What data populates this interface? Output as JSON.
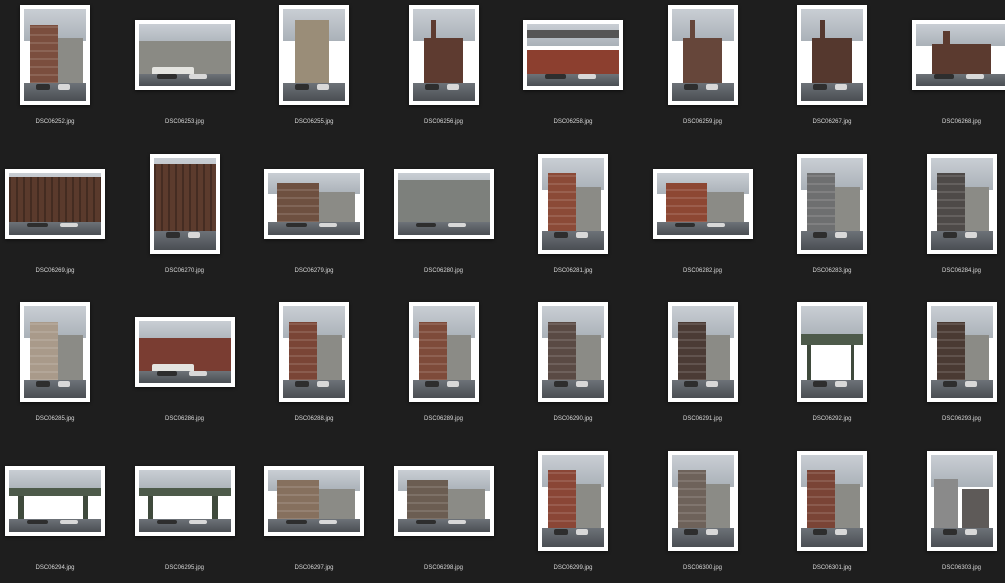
{
  "files": [
    {
      "name": "DSC06252.jpg",
      "orientation": "portrait",
      "scene": "building",
      "color": "#7b4e3e"
    },
    {
      "name": "DSC06253.jpg",
      "orientation": "landscape",
      "scene": "car",
      "color": "#8a8a84"
    },
    {
      "name": "DSC06255.jpg",
      "orientation": "portrait",
      "scene": "tower",
      "color": "#9a8d78"
    },
    {
      "name": "DSC06256.jpg",
      "orientation": "portrait",
      "scene": "factory",
      "color": "#5e3b30"
    },
    {
      "name": "DSC06258.jpg",
      "orientation": "landscape",
      "scene": "bridge",
      "color": "#8c3f2f"
    },
    {
      "name": "DSC06259.jpg",
      "orientation": "portrait",
      "scene": "factory",
      "color": "#66463a"
    },
    {
      "name": "DSC06267.jpg",
      "orientation": "portrait",
      "scene": "factory",
      "color": "#55382e"
    },
    {
      "name": "DSC06268.jpg",
      "orientation": "landscape",
      "scene": "factory",
      "color": "#5b3a2f"
    },
    {
      "name": "DSC06269.jpg",
      "orientation": "landscape",
      "scene": "ruin",
      "color": "#5a3a2c"
    },
    {
      "name": "DSC06270.jpg",
      "orientation": "portrait",
      "scene": "ruin",
      "color": "#5c3b2d"
    },
    {
      "name": "DSC06279.jpg",
      "orientation": "landscape",
      "scene": "street",
      "color": "#6e5040"
    },
    {
      "name": "DSC06280.jpg",
      "orientation": "landscape",
      "scene": "wall",
      "color": "#7d807c"
    },
    {
      "name": "DSC06281.jpg",
      "orientation": "portrait",
      "scene": "building",
      "color": "#8b4a37"
    },
    {
      "name": "DSC06282.jpg",
      "orientation": "landscape",
      "scene": "building",
      "color": "#8d4733"
    },
    {
      "name": "DSC06283.jpg",
      "orientation": "portrait",
      "scene": "street",
      "color": "#6e6f70"
    },
    {
      "name": "DSC06284.jpg",
      "orientation": "portrait",
      "scene": "building",
      "color": "#4e4a48"
    },
    {
      "name": "DSC06285.jpg",
      "orientation": "portrait",
      "scene": "building",
      "color": "#a99a8a"
    },
    {
      "name": "DSC06286.jpg",
      "orientation": "landscape",
      "scene": "car",
      "color": "#7a3d32"
    },
    {
      "name": "DSC06288.jpg",
      "orientation": "portrait",
      "scene": "street",
      "color": "#7a4536"
    },
    {
      "name": "DSC06289.jpg",
      "orientation": "portrait",
      "scene": "street",
      "color": "#7e4b3a"
    },
    {
      "name": "DSC06290.jpg",
      "orientation": "portrait",
      "scene": "street",
      "color": "#5a4a44"
    },
    {
      "name": "DSC06291.jpg",
      "orientation": "portrait",
      "scene": "building",
      "color": "#4b3b35"
    },
    {
      "name": "DSC06292.jpg",
      "orientation": "portrait",
      "scene": "overpass",
      "color": "#506048"
    },
    {
      "name": "DSC06293.jpg",
      "orientation": "portrait",
      "scene": "building",
      "color": "#4a3a33"
    },
    {
      "name": "DSC06294.jpg",
      "orientation": "landscape",
      "scene": "overpass",
      "color": "#4f5e4c"
    },
    {
      "name": "DSC06295.jpg",
      "orientation": "landscape",
      "scene": "overpass",
      "color": "#546152"
    },
    {
      "name": "DSC06297.jpg",
      "orientation": "landscape",
      "scene": "street",
      "color": "#86705e"
    },
    {
      "name": "DSC06298.jpg",
      "orientation": "landscape",
      "scene": "street",
      "color": "#6b5d52"
    },
    {
      "name": "DSC06299.jpg",
      "orientation": "portrait",
      "scene": "building",
      "color": "#8a4636"
    },
    {
      "name": "DSC06300.jpg",
      "orientation": "portrait",
      "scene": "building",
      "color": "#6e625a"
    },
    {
      "name": "DSC06301.jpg",
      "orientation": "portrait",
      "scene": "building",
      "color": "#7a4436"
    },
    {
      "name": "DSC06303.jpg",
      "orientation": "portrait",
      "scene": "rooftop",
      "color": "#5e5a58"
    }
  ]
}
